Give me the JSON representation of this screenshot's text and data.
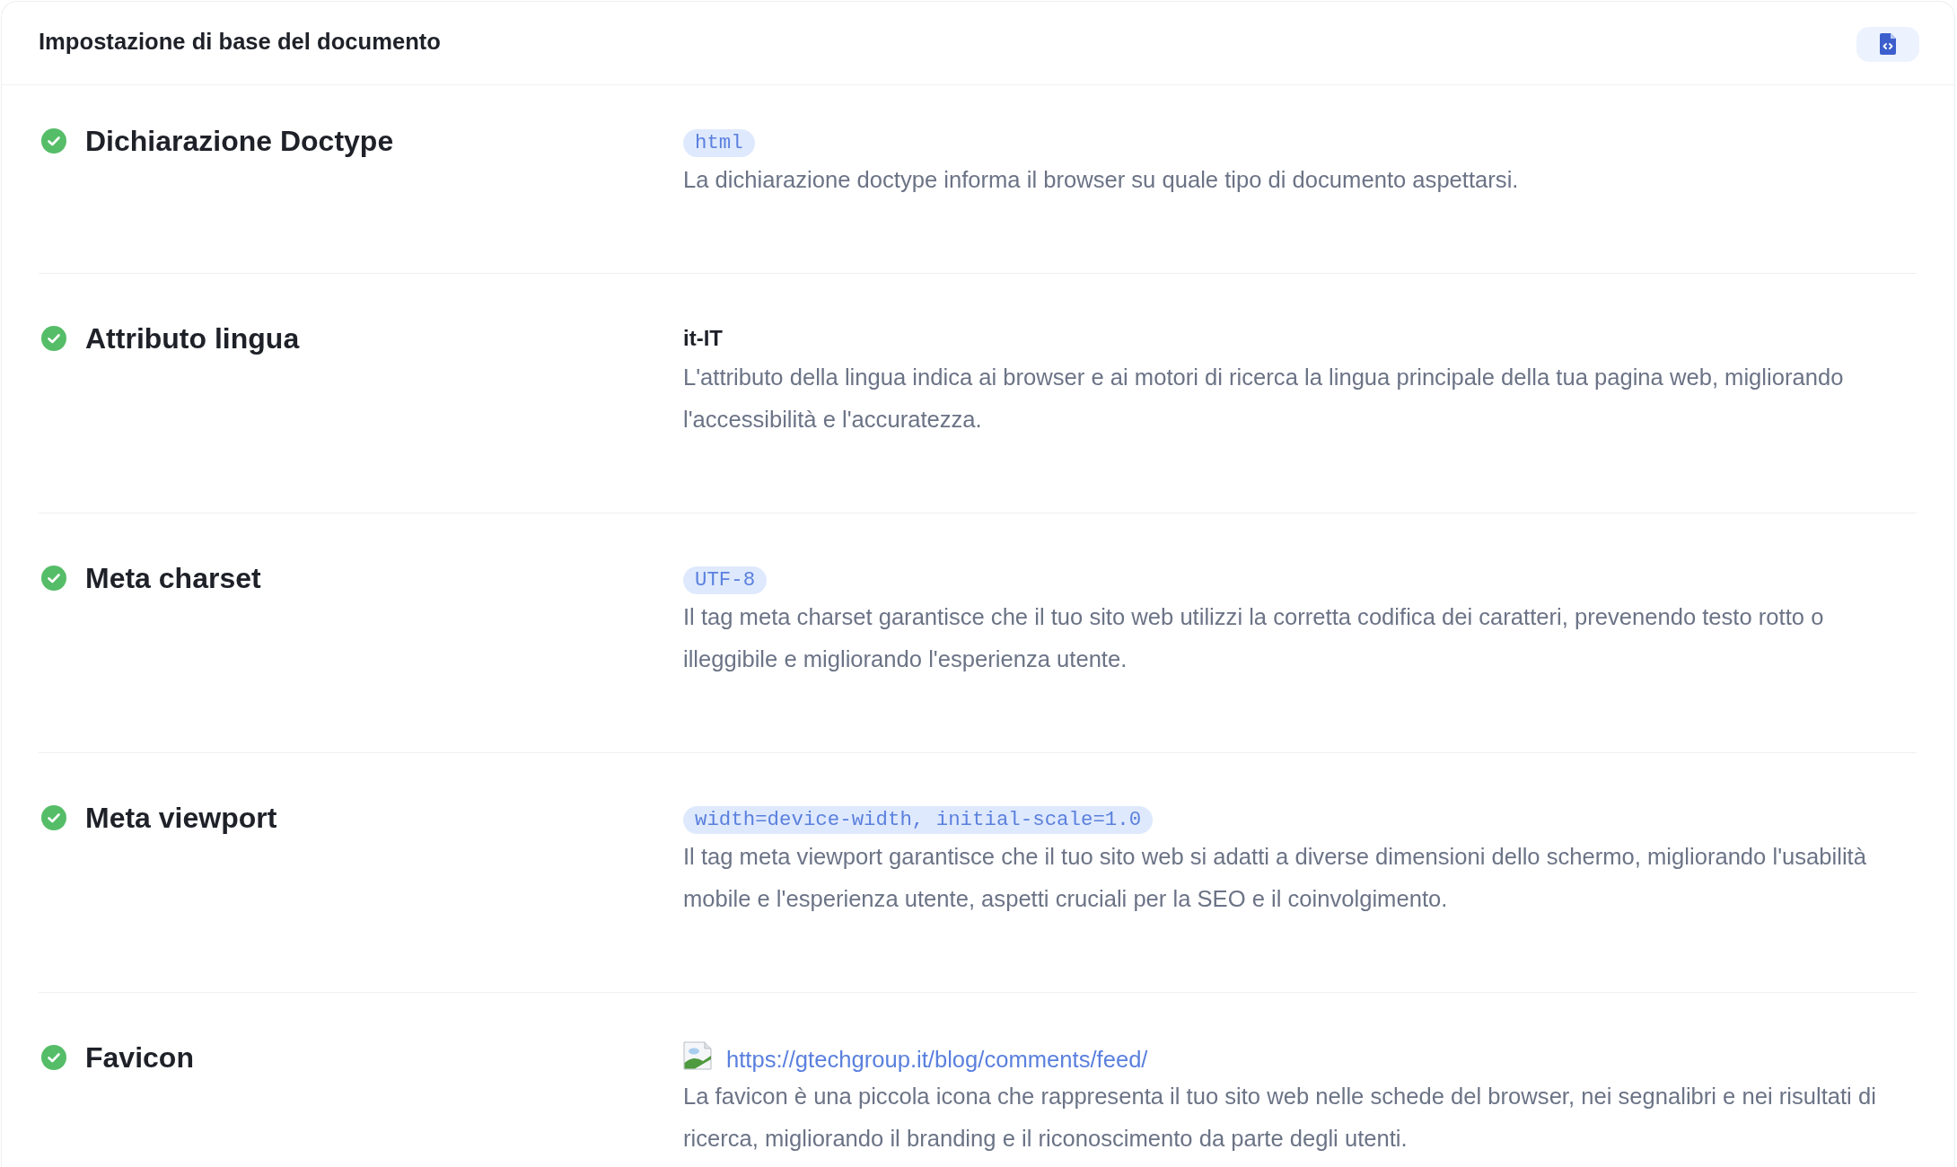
{
  "header": {
    "title": "Impostazione di base del documento"
  },
  "checks": [
    {
      "title": "Dichiarazione Doctype",
      "passed": true,
      "value": {
        "kind": "code",
        "text": "html"
      },
      "description": "La dichiarazione doctype informa il browser su quale tipo di documento aspettarsi."
    },
    {
      "title": "Attributo lingua",
      "passed": true,
      "value": {
        "kind": "text",
        "text": "it-IT"
      },
      "description": "L'attributo della lingua indica ai browser e ai motori di ricerca la lingua principale della tua pagina web, migliorando l'accessibilità e l'accuratezza."
    },
    {
      "title": "Meta charset",
      "passed": true,
      "value": {
        "kind": "code",
        "text": "UTF-8"
      },
      "description": "Il tag meta charset garantisce che il tuo sito web utilizzi la corretta codifica dei caratteri, prevenendo testo rotto o illeggibile e migliorando l'esperienza utente."
    },
    {
      "title": "Meta viewport",
      "passed": true,
      "value": {
        "kind": "code",
        "text": "width=device-width, initial-scale=1.0"
      },
      "description": "Il tag meta viewport garantisce che il tuo sito web si adatti a diverse dimensioni dello schermo, migliorando l'usabilità mobile e l'esperienza utente, aspetti cruciali per la SEO e il coinvolgimento."
    },
    {
      "title": "Favicon",
      "passed": true,
      "value": {
        "kind": "link",
        "text": "https://gtechgroup.it/blog/comments/feed/"
      },
      "description": "La favicon è una piccola icona che rappresenta il tuo sito web nelle schede del browser, nei segnalibri e nei risultati di ricerca, migliorando il branding e il riconoscimento da parte degli utenti."
    }
  ]
}
